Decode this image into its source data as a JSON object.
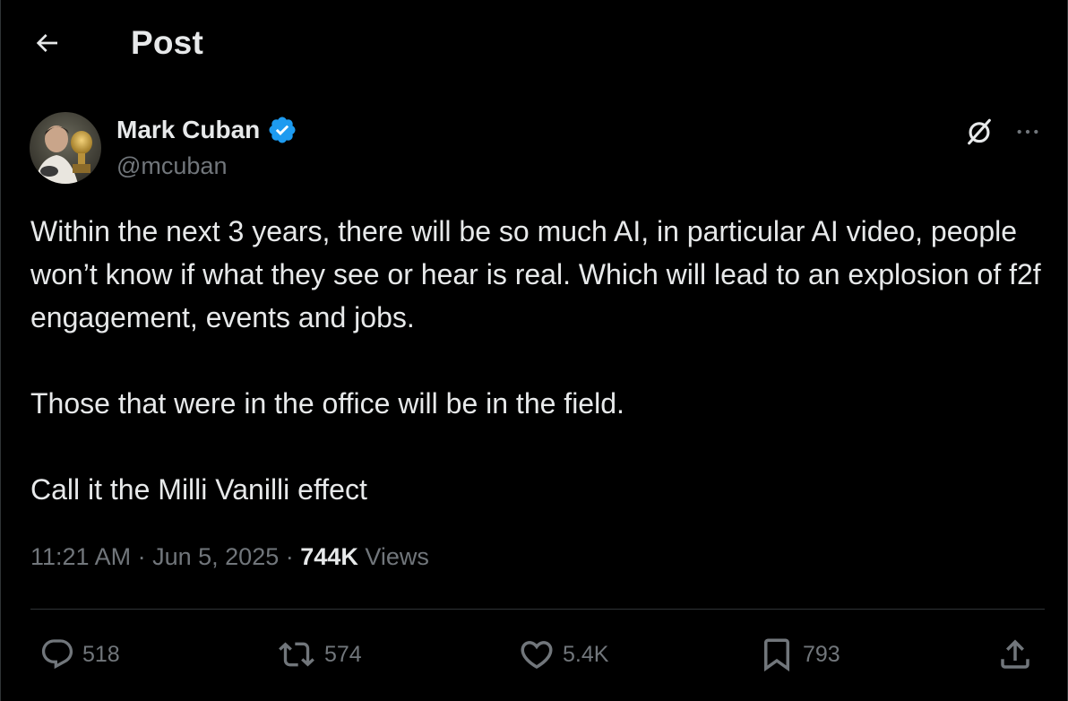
{
  "header": {
    "title": "Post",
    "back_icon": "arrow-left-icon"
  },
  "author": {
    "name": "Mark Cuban",
    "handle": "@mcuban",
    "verified_icon": "verified-badge-icon",
    "verified_color": "#1d9bf0"
  },
  "post": {
    "paragraphs": [
      "Within the next 3 years, there will be so much AI, in particular AI video, people won’t know if what they see or hear is real.  Which will lead to an explosion of f2f engagement, events and jobs.",
      "Those that were in the office will be in the field.",
      "Call it the Milli Vanilli effect"
    ],
    "time": "11:21 AM",
    "date": "Jun 5, 2025",
    "separator": "·",
    "views_count": "744K",
    "views_label": "Views"
  },
  "actions": {
    "replies": "518",
    "reposts": "574",
    "likes": "5.4K",
    "bookmarks": "793"
  },
  "icons": {
    "grok": "grok-icon",
    "more": "more-dots-icon",
    "reply": "reply-bubble-icon",
    "repost": "repost-arrows-icon",
    "like": "heart-icon",
    "bookmark": "bookmark-icon",
    "share": "share-upload-icon"
  },
  "colors": {
    "background": "#000000",
    "text_primary": "#e7e9ea",
    "text_secondary": "#71767b",
    "divider": "#2f3336",
    "accent": "#1d9bf0"
  }
}
